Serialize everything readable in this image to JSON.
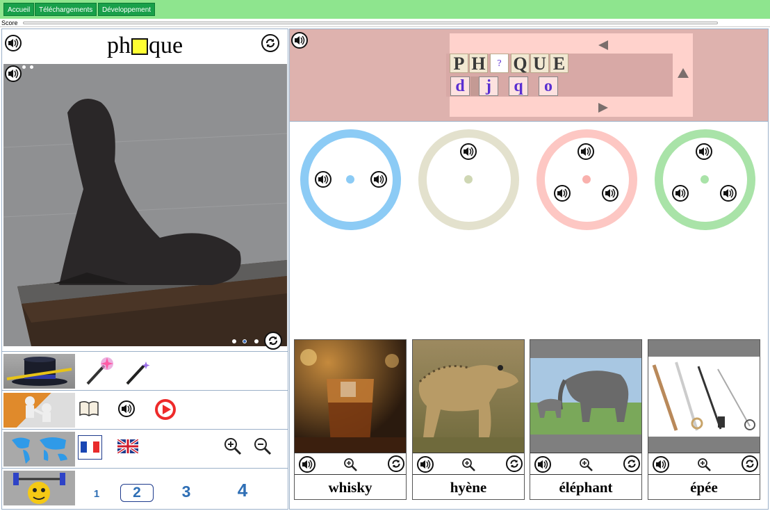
{
  "nav": {
    "home": "Accueil",
    "downloads": "Téléchargements",
    "development": "Développement"
  },
  "score": {
    "label": "Score"
  },
  "word": {
    "prefix": "ph",
    "suffix": "que"
  },
  "target_letters": [
    "P",
    "H",
    "?",
    "Q",
    "U",
    "E"
  ],
  "choices": [
    "d",
    "j",
    "q",
    "o"
  ],
  "languages": [
    "French",
    "English"
  ],
  "levels": [
    "1",
    "2",
    "3",
    "4"
  ],
  "circles": [
    {
      "color": "#8ccbf5",
      "dot": "#8ccbf5"
    },
    {
      "color": "#e3e1cd",
      "dot": "#cfd7b4"
    },
    {
      "color": "#fdc7c3",
      "dot": "#f9b1ad"
    },
    {
      "color": "#a9e3a8",
      "dot": "#a9e3a8"
    }
  ],
  "cards": [
    {
      "word": "whisky"
    },
    {
      "word": "hyène"
    },
    {
      "word": "éléphant"
    },
    {
      "word": "épée"
    }
  ]
}
